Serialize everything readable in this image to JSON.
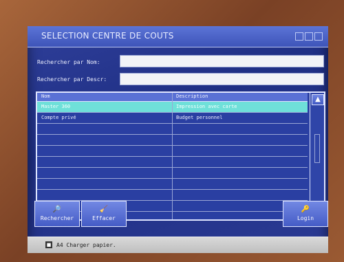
{
  "window": {
    "title": "SELECTION CENTRE DE COUTS"
  },
  "search": {
    "name_label": "Rechercher par Nom:",
    "name_value": "",
    "desc_label": "Rechercher par Descr:",
    "desc_value": ""
  },
  "table": {
    "headers": [
      "Nom",
      "Description"
    ],
    "rows": [
      {
        "name": "Master 360",
        "description": "Impression avec carte",
        "selected": true
      },
      {
        "name": "Compte privé",
        "description": "Budget personnel",
        "selected": false
      }
    ]
  },
  "buttons": {
    "search_label": "Rechercher",
    "clear_label": "Effacer",
    "login_label": "Login"
  },
  "status": {
    "tray": "A4",
    "message": "Charger papier."
  },
  "colors": {
    "selected_row": "#6fe0d9",
    "screen_bg": "#1f2f84"
  }
}
